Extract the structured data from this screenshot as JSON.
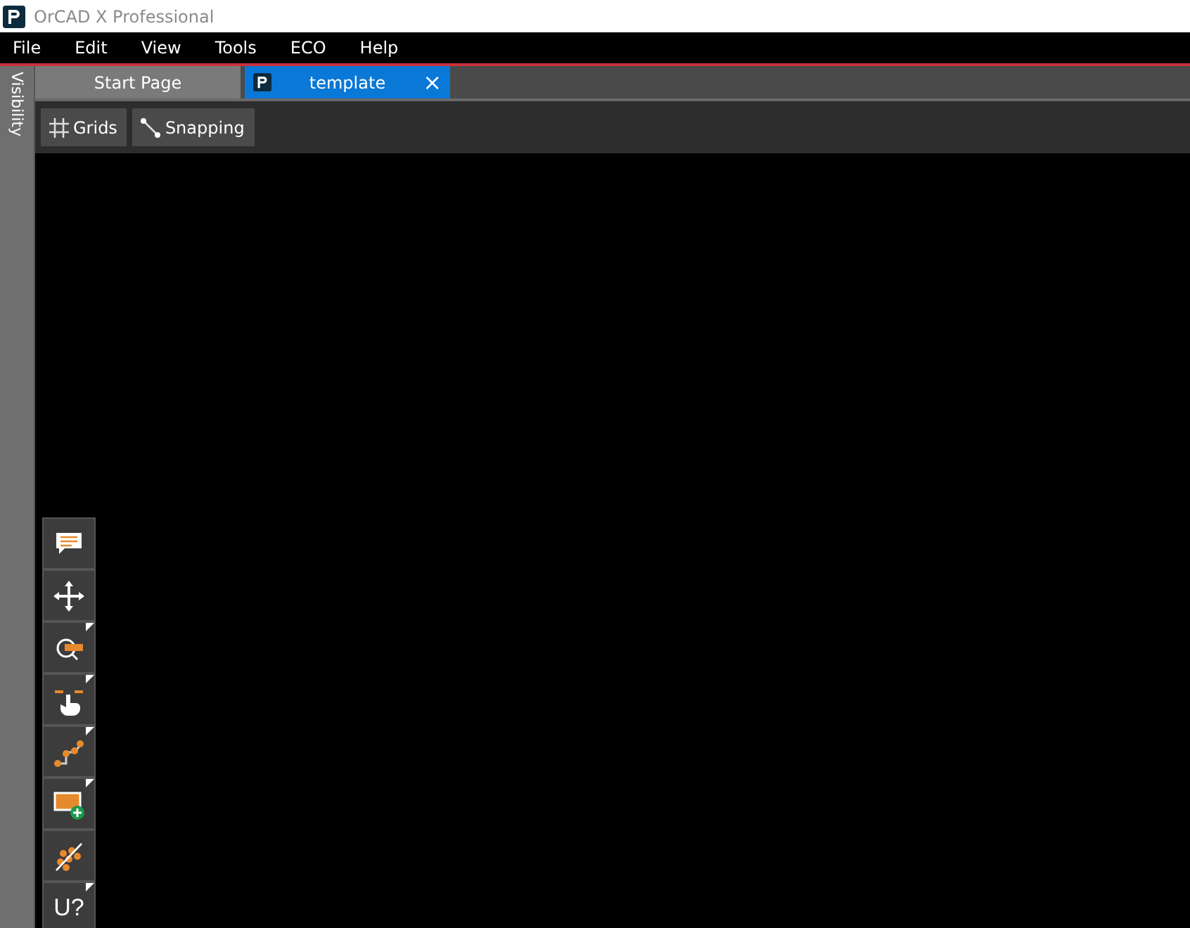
{
  "window": {
    "title": "OrCAD X Professional"
  },
  "menu": [
    "File",
    "Edit",
    "View",
    "Tools",
    "ECO",
    "Help"
  ],
  "side_panel": {
    "label": "Visibility"
  },
  "tabs": [
    {
      "label": "Start Page",
      "selected": false
    },
    {
      "label": "template",
      "selected": true,
      "close": "×"
    }
  ],
  "toolbar": [
    {
      "kind": "grids",
      "label": "Grids"
    },
    {
      "kind": "snapping",
      "label": "Snapping"
    }
  ],
  "tools": [
    {
      "kind": "comment",
      "flyout": false
    },
    {
      "kind": "move",
      "flyout": false
    },
    {
      "kind": "zoom",
      "flyout": true
    },
    {
      "kind": "pan",
      "flyout": true
    },
    {
      "kind": "route",
      "flyout": true
    },
    {
      "kind": "add-shape",
      "flyout": true
    },
    {
      "kind": "ratsnest",
      "flyout": false
    },
    {
      "kind": "text",
      "label": "U?",
      "flyout": true
    }
  ]
}
